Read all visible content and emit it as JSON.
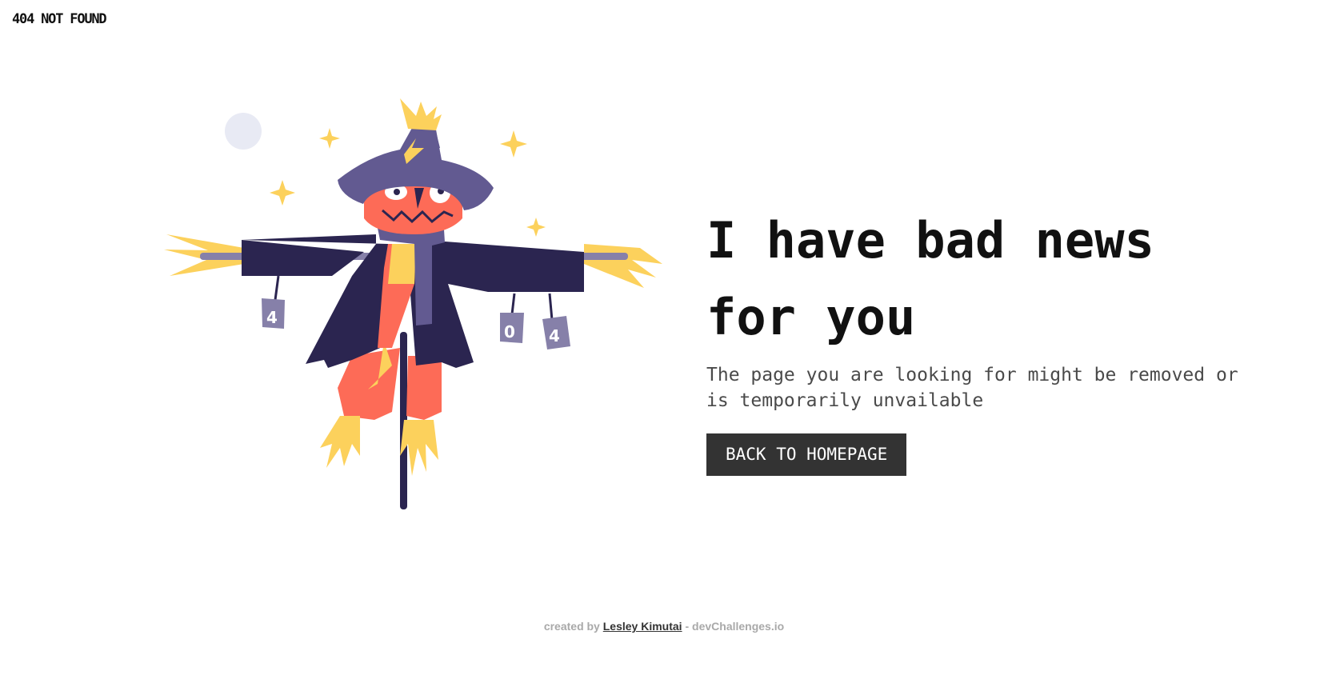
{
  "brand": {
    "text": "404 NOT FOUND"
  },
  "hero": {
    "headline": "I have bad news for you",
    "subtext": "The page you are looking for might be removed or is temporarily unvailable",
    "cta_label": "BACK TO HOMEPAGE"
  },
  "illustration": {
    "can_labels": [
      "4",
      "0",
      "4"
    ]
  },
  "footer": {
    "prefix": "created by",
    "author": "Lesley Kimutai",
    "separator": "-",
    "site": "devChallenges.io"
  },
  "colors": {
    "button_bg": "#333333",
    "scarecrow_coat": "#2b2550",
    "scarecrow_hat": "#625a91",
    "straw": "#fcd15c",
    "pumpkin": "#fd6b57"
  }
}
